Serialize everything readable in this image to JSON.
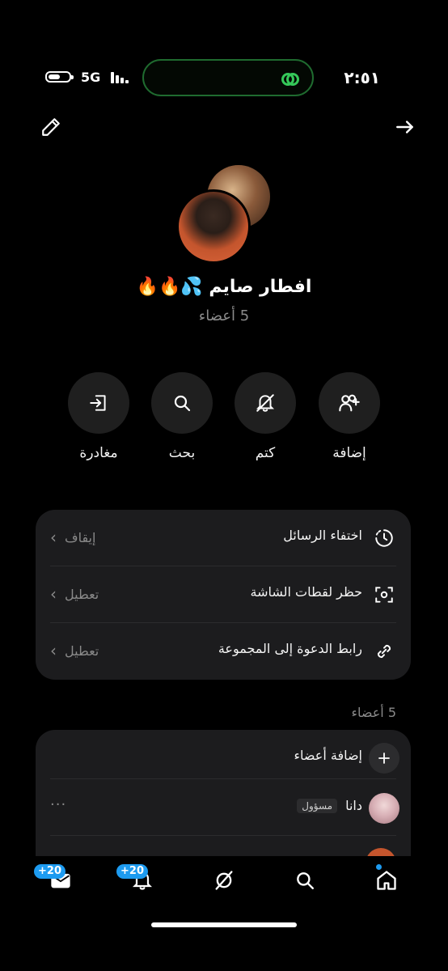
{
  "status": {
    "network": "5G",
    "time": "٢:٥١"
  },
  "group": {
    "name": "افطار صايم 💦🔥🔥",
    "members_label": "5 أعضاء"
  },
  "actions": [
    {
      "label": "إضافة",
      "icon": "add-users-icon"
    },
    {
      "label": "كتم",
      "icon": "mute-bell-icon"
    },
    {
      "label": "بحث",
      "icon": "search-icon"
    },
    {
      "label": "مغادرة",
      "icon": "leave-icon"
    }
  ],
  "settings": [
    {
      "title": "اختفاء الرسائل",
      "value": "إيقاف",
      "icon": "timer-icon"
    },
    {
      "title": "حظر لقطات الشاشة",
      "value": "تعطيل",
      "icon": "screenshot-icon"
    },
    {
      "title": "رابط الدعوة إلى المجموعة",
      "value": "تعطيل",
      "icon": "link-icon"
    }
  ],
  "members": {
    "header": "5 أعضاء",
    "add_label": "إضافة أعضاء",
    "list": [
      {
        "name": "دانا",
        "role": "مسؤول"
      }
    ]
  },
  "nav": {
    "messages_badge": "+20",
    "notifications_badge": "+20"
  },
  "colors": {
    "accent": "#1d9bf0",
    "island_icon": "#35c759",
    "card_bg": "#1c1c1e"
  }
}
